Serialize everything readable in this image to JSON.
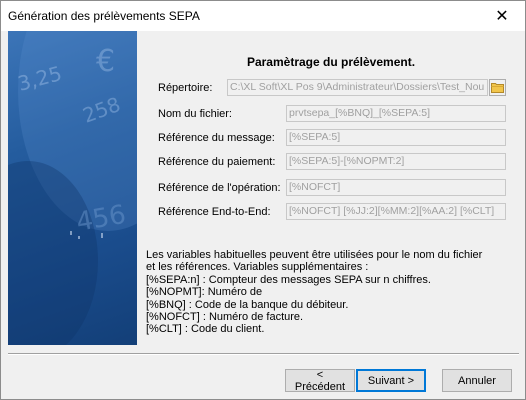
{
  "window": {
    "title": "Génération des prélèvements SEPA",
    "close_icon": "close-icon"
  },
  "banner": {
    "decor_texts": [
      "3,25",
      "€",
      "258",
      "456"
    ]
  },
  "form": {
    "heading": "Paramètrage du prélèvement.",
    "repertoire": {
      "label": "Répertoire:",
      "value": "C:\\XL Soft\\XL Pos 9\\Administrateur\\Dossiers\\Test_Nou"
    },
    "nom_fichier": {
      "label": "Nom du fichier:",
      "value": "prvtsepa_[%BNQ]_[%SEPA:5]"
    },
    "ref_message": {
      "label": "Référence du message:",
      "value": "[%SEPA:5]"
    },
    "ref_paiement": {
      "label": "Référence du paiement:",
      "value": "[%SEPA:5]-[%NOPMT:2]"
    },
    "ref_operation": {
      "label": "Référence de l'opération:",
      "value": "[%NOFCT]"
    },
    "ref_end_to_end": {
      "label": "Référence End-to-End:",
      "value": "[%NOFCT] [%JJ:2][%MM:2][%AA:2] [%CLT]"
    },
    "folder_button_icon": "folder-icon"
  },
  "info": {
    "lines": [
      "Les variables habituelles peuvent être utilisées pour le nom du fichier",
      "et les références. Variables supplémentaires :",
      "[%SEPA:n] : Compteur des messages SEPA sur n chiffres.",
      "[%NOPMT]: Numéro de",
      "[%BNQ] : Code de la banque du débiteur.",
      "[%NOFCT] : Numéro de facture.",
      "[%CLT] : Code du client."
    ]
  },
  "buttons": {
    "previous": "< Précédent",
    "next": "Suivant >",
    "cancel": "Annuler"
  },
  "colors": {
    "banner": "#1f5495",
    "default_button_border": "#0078d7",
    "folder_icon": "#e8b737"
  }
}
